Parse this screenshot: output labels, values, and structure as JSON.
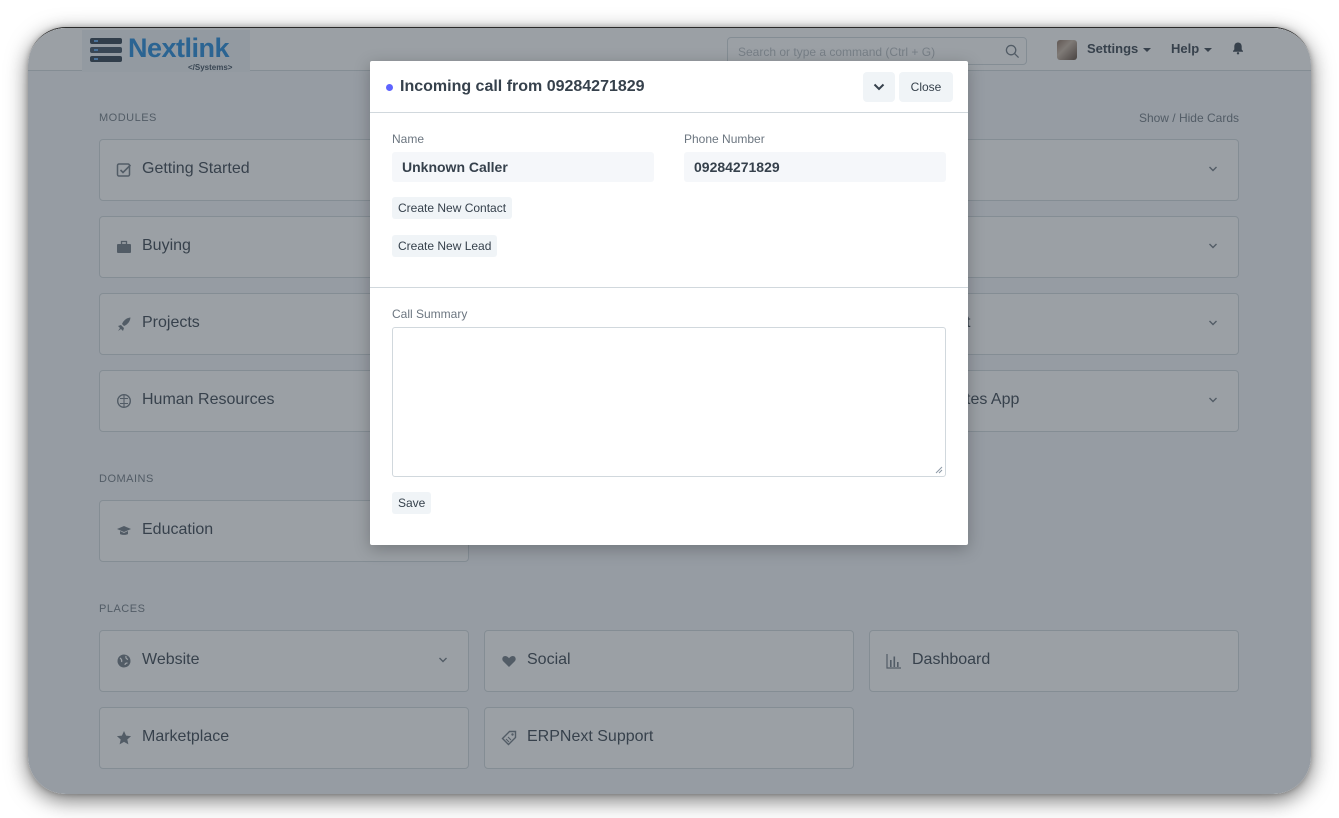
{
  "navbar": {
    "logo_text": "Nextlink",
    "logo_sub": "</Systems>",
    "search_placeholder": "Search or type a command (Ctrl + G)",
    "settings_label": "Settings",
    "help_label": "Help"
  },
  "desk": {
    "modules_label": "MODULES",
    "show_hide_label": "Show / Hide Cards",
    "modules": [
      {
        "label": "Getting Started",
        "icon": "checkbox-icon"
      },
      {
        "label": "Buying",
        "icon": "briefcase-icon"
      },
      {
        "label": "Projects",
        "icon": "rocket-icon"
      },
      {
        "label": "Human Resources",
        "icon": "brain-icon"
      }
    ],
    "modules_right": [
      {
        "label": ""
      },
      {
        "label": ""
      },
      {
        "label": "t"
      },
      {
        "label": "tes App"
      }
    ],
    "domains_label": "DOMAINS",
    "domains": [
      {
        "label": "Education",
        "icon": "graduation-cap-icon"
      }
    ],
    "places_label": "PLACES",
    "places": [
      {
        "label": "Website",
        "icon": "globe-icon"
      },
      {
        "label": "Social",
        "icon": "heart-icon"
      },
      {
        "label": "Dashboard",
        "icon": "bar-chart-icon"
      },
      {
        "label": "Marketplace",
        "icon": "star-icon"
      },
      {
        "label": "ERPNext Support",
        "icon": "tag-icon"
      }
    ]
  },
  "modal": {
    "title": "Incoming call from 09284271829",
    "close_label": "Close",
    "name_label": "Name",
    "name_value": "Unknown Caller",
    "phone_label": "Phone Number",
    "phone_value": "09284271829",
    "create_contact_label": "Create New Contact",
    "create_lead_label": "Create New Lead",
    "summary_label": "Call Summary",
    "summary_value": "",
    "save_label": "Save",
    "indicator_color": "#5e64ff"
  }
}
